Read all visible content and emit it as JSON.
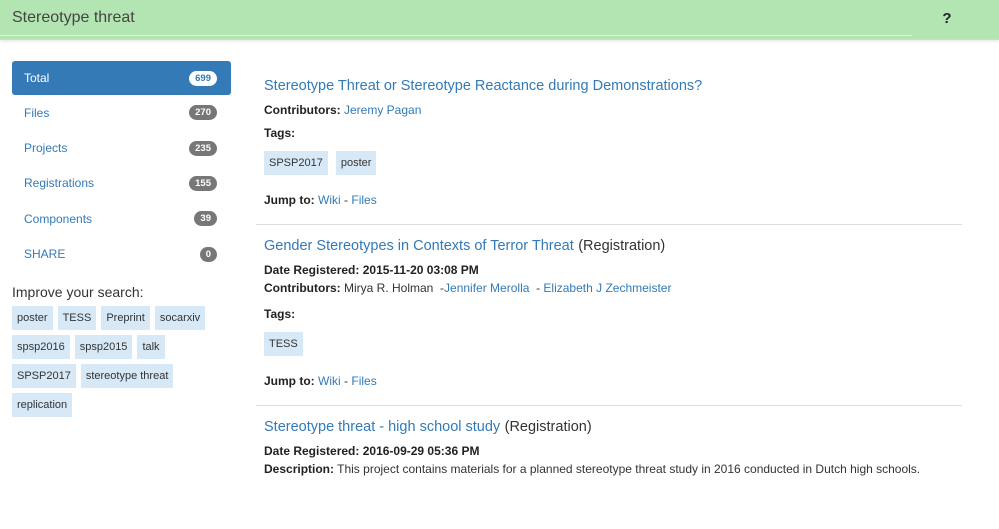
{
  "search": {
    "query": "Stereotype threat",
    "help_label": "?"
  },
  "sidebar": {
    "facets": [
      {
        "label": "Total",
        "count": "699"
      },
      {
        "label": "Files",
        "count": "270"
      },
      {
        "label": "Projects",
        "count": "235"
      },
      {
        "label": "Registrations",
        "count": "155"
      },
      {
        "label": "Components",
        "count": "39"
      },
      {
        "label": "SHARE",
        "count": "0"
      }
    ],
    "improve_title": "Improve your search:",
    "tags": [
      "poster",
      "TESS",
      "Preprint",
      "socarxiv",
      "spsp2016",
      "spsp2015",
      "talk",
      "SPSP2017",
      "stereotype threat",
      "replication"
    ]
  },
  "labels": {
    "contributors": "Contributors:",
    "tags": "Tags:",
    "jump_to": "Jump to:",
    "date_registered": "Date Registered:",
    "description": "Description:",
    "wiki": "Wiki",
    "files": "Files",
    "dash": "-"
  },
  "results": [
    {
      "title": "Stereotype Threat or Stereotype Reactance during Demonstrations?",
      "contributors": [
        "Jeremy Pagan"
      ],
      "tags": [
        "SPSP2017",
        "poster"
      ]
    },
    {
      "title": "Gender Stereotypes in Contexts of Terror Threat",
      "type": "(Registration)",
      "date": "2015-11-20 03:08 PM",
      "contributor_plain": "Mirya R. Holman",
      "contributors": [
        "Jennifer Merolla",
        "Elizabeth J Zechmeister"
      ],
      "tags": [
        "TESS"
      ]
    },
    {
      "title": "Stereotype threat - high school study",
      "type": "(Registration)",
      "date": "2016-09-29 05:36 PM",
      "description": "This project contains materials for a planned stereotype threat study in 2016 conducted in Dutch high schools."
    }
  ],
  "colors": {
    "header_bg": "#b3e5b3",
    "accent": "#337ab7",
    "tag_bg": "#d7e9f7"
  }
}
